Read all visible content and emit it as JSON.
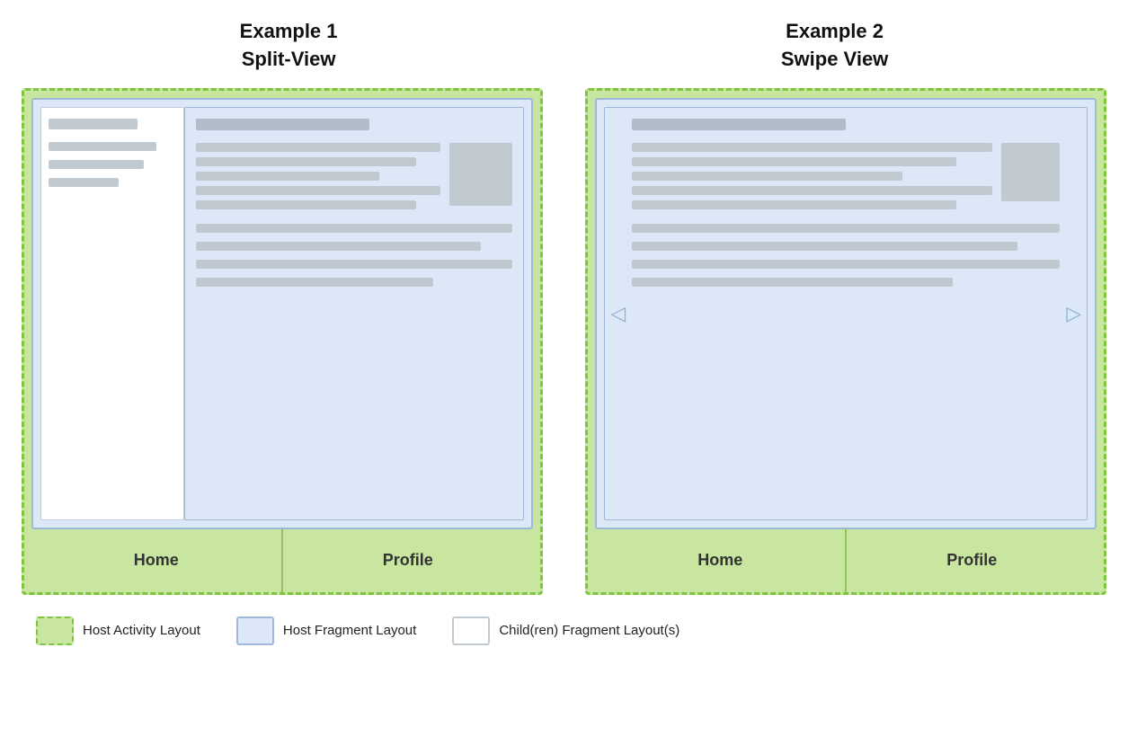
{
  "example1": {
    "title_line1": "Example 1",
    "title_line2": "Split-View"
  },
  "example2": {
    "title_line1": "Example 2",
    "title_line2": "Swipe View"
  },
  "nav": {
    "home": "Home",
    "profile": "Profile"
  },
  "legend": {
    "host_activity": "Host Activity Layout",
    "host_fragment": "Host Fragment Layout",
    "child_fragment": "Child(ren) Fragment Layout(s)"
  },
  "arrows": {
    "left": "◁",
    "right": "▷"
  }
}
